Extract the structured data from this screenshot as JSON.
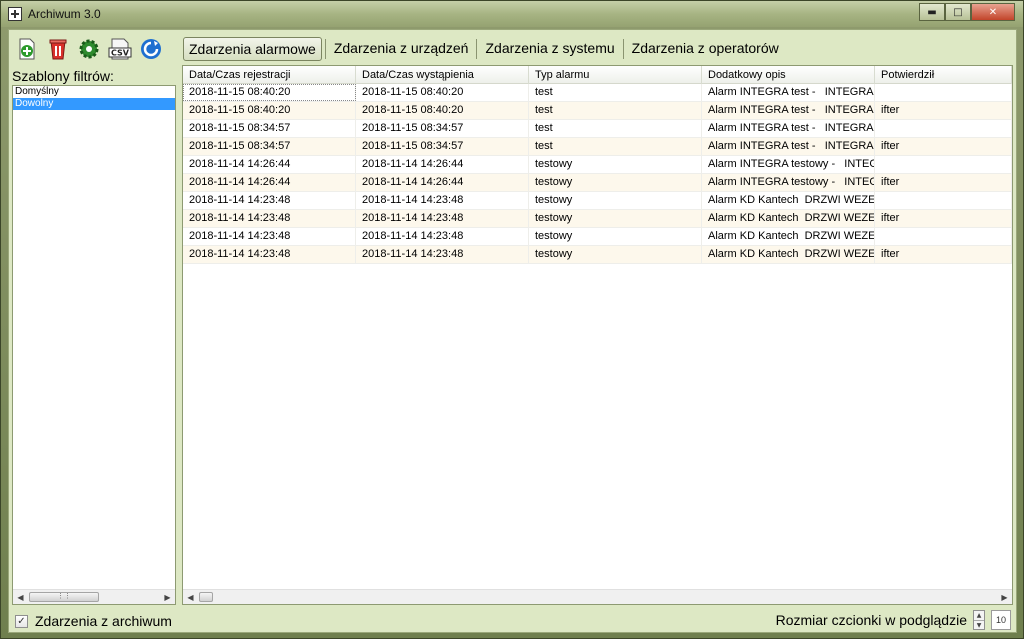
{
  "window": {
    "title": "Archiwum 3.0"
  },
  "toolbar": {
    "buttons": [
      {
        "icon": "add-document-icon"
      },
      {
        "icon": "delete-icon"
      },
      {
        "icon": "settings-gear-icon"
      },
      {
        "icon": "csv-export-icon",
        "label": "CSV"
      },
      {
        "icon": "refresh-icon"
      }
    ]
  },
  "tabs": [
    {
      "label": "Zdarzenia alarmowe",
      "active": true
    },
    {
      "label": "Zdarzenia z urządzeń"
    },
    {
      "label": "Zdarzenia z systemu"
    },
    {
      "label": "Zdarzenia z operatorów"
    }
  ],
  "filters": {
    "title": "Szablony filtrów:",
    "items": [
      {
        "label": "Domyślny"
      },
      {
        "label": "Dowolny",
        "selected": true
      }
    ]
  },
  "grid": {
    "columns": [
      "Data/Czas rejestracji",
      "Data/Czas wystąpienia",
      "Typ alarmu",
      "Dodatkowy opis",
      "Potwierdził"
    ],
    "rows": [
      [
        "2018-11-15 08:40:20",
        "2018-11-15 08:40:20",
        "test",
        "Alarm INTEGRA test -   INTEGRA",
        ""
      ],
      [
        "2018-11-15 08:40:20",
        "2018-11-15 08:40:20",
        "test",
        "Alarm INTEGRA test -   INTEGRA",
        "ifter"
      ],
      [
        "2018-11-15 08:34:57",
        "2018-11-15 08:34:57",
        "test",
        "Alarm INTEGRA test -   INTEGRA",
        ""
      ],
      [
        "2018-11-15 08:34:57",
        "2018-11-15 08:34:57",
        "test",
        "Alarm INTEGRA test -   INTEGRA",
        "ifter"
      ],
      [
        "2018-11-14 14:26:44",
        "2018-11-14 14:26:44",
        "testowy",
        "Alarm INTEGRA testowy -   INTEG",
        ""
      ],
      [
        "2018-11-14 14:26:44",
        "2018-11-14 14:26:44",
        "testowy",
        "Alarm INTEGRA testowy -   INTEG",
        "ifter"
      ],
      [
        "2018-11-14 14:23:48",
        "2018-11-14 14:23:48",
        "testowy",
        "Alarm KD Kantech  DRZWI WEZEL",
        ""
      ],
      [
        "2018-11-14 14:23:48",
        "2018-11-14 14:23:48",
        "testowy",
        "Alarm KD Kantech  DRZWI WEZEL",
        "ifter"
      ],
      [
        "2018-11-14 14:23:48",
        "2018-11-14 14:23:48",
        "testowy",
        "Alarm KD Kantech  DRZWI WEZEL",
        ""
      ],
      [
        "2018-11-14 14:23:48",
        "2018-11-14 14:23:48",
        "testowy",
        "Alarm KD Kantech  DRZWI WEZEL",
        "ifter"
      ]
    ]
  },
  "footer": {
    "archive_checkbox_checked": true,
    "archive_label": "Zdarzenia z archiwum",
    "font_size_label": "Rozmiar czcionki w podglądzie",
    "font_size_value": "10"
  },
  "colors": {
    "client_bg": "#dde8c4",
    "selection": "#3399ff",
    "row_alt": "#fdf8ec"
  }
}
